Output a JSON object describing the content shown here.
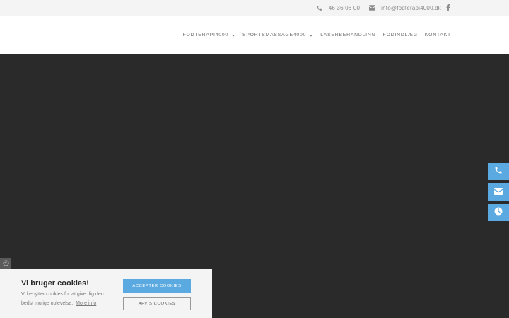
{
  "topbar": {
    "phone_icon": "phone-icon",
    "phone": "46 36 06 00",
    "mail_icon": "envelope-icon",
    "email": "info@fodterapi4000.dk",
    "social_icon": "facebook-icon"
  },
  "nav": {
    "items": [
      {
        "label": "FODTERAPI4000",
        "dropdown": true
      },
      {
        "label": "SPORTSMASSAGE4000",
        "dropdown": true
      },
      {
        "label": "LASERBEHANDLING",
        "dropdown": false
      },
      {
        "label": "FODINDLÆG",
        "dropdown": false
      },
      {
        "label": "KONTAKT",
        "dropdown": false
      }
    ]
  },
  "side_buttons": [
    {
      "icon": "phone-icon"
    },
    {
      "icon": "envelope-icon"
    },
    {
      "icon": "clock-icon"
    }
  ],
  "cookie": {
    "title": "Vi bruger cookies!",
    "text": "Vi benytter cookies for at give dig den bedst mulige oplevelse.",
    "more_info": "More info",
    "accept_label": "ACCEPTER COOKIES",
    "reject_label": "AFVIS COOKIES"
  },
  "colors": {
    "accent": "#5aa9e0",
    "hero_bg": "#2a2a2a",
    "topbar_bg": "#f4f4f4"
  }
}
